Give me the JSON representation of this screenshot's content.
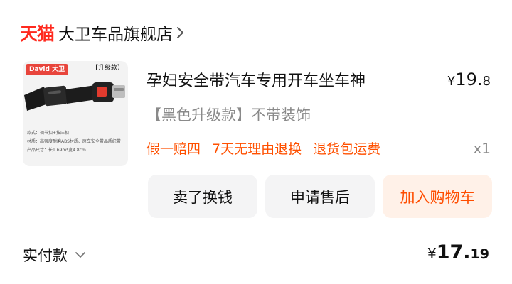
{
  "store": {
    "platform_logo": "天猫",
    "name": "大卫车品旗舰店",
    "chevron_icon": "chevron-right-icon"
  },
  "product": {
    "image": {
      "brand_tag": "David 大卫",
      "badge": "【升级款】",
      "spec_lines": [
        "款式：调节扣+按压扣",
        "材质：高强度耐磨ABS材质、原车安全带品质织带",
        "产品尺寸：长1.69m*宽4.8cm"
      ]
    },
    "title": "孕妇安全带汽车专用开车坐车神",
    "price": {
      "symbol": "¥",
      "integer": "19.",
      "decimal": "8"
    },
    "variant": "【黑色升级款】不带装饰",
    "promos": [
      "假一赔四",
      "7天无理由退换",
      "退货包运费"
    ],
    "quantity": "x1"
  },
  "actions": {
    "sell": "卖了换钱",
    "aftersale": "申请售后",
    "add_to_cart": "加入购物车"
  },
  "payment": {
    "label": "实付款",
    "symbol": "¥",
    "integer": "17.",
    "decimal": "19"
  },
  "colors": {
    "brand_red": "#ff2a1f",
    "promo_orange": "#ff5000",
    "cart_button_bg": "#fff1e8",
    "button_bg": "#f4f4f5"
  }
}
